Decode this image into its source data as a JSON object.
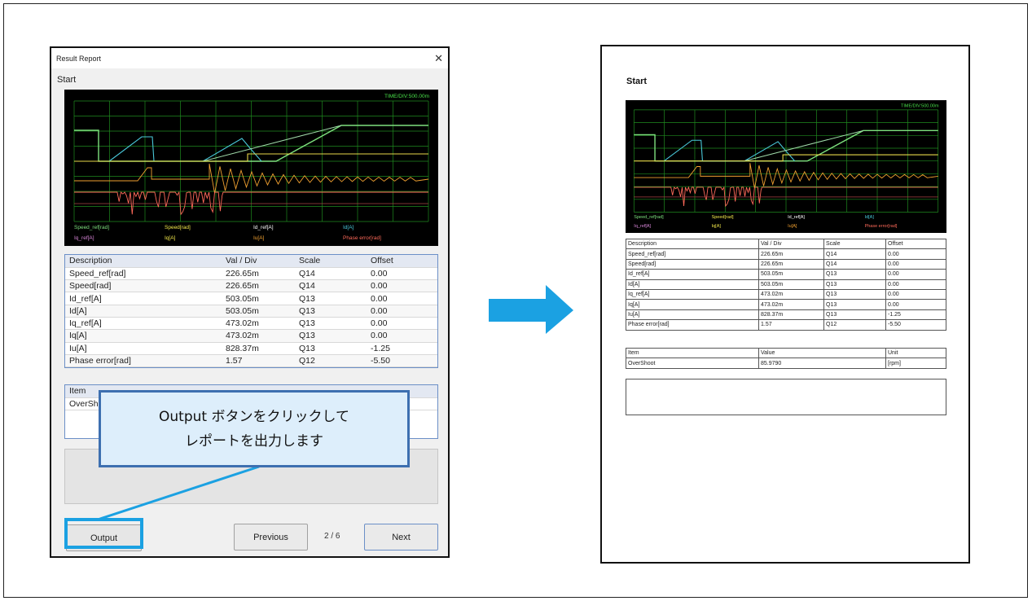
{
  "dialog": {
    "title": "Result Report",
    "section_title": "Start",
    "scope": {
      "time_div": "TIME/DIV:500.00m",
      "legend_row1": [
        {
          "label": "Speed_ref[rad]",
          "color": "#7ee07e"
        },
        {
          "label": "Speed[rad]",
          "color": "#f0e64a"
        },
        {
          "label": "Id_ref[A]",
          "color": "#ffffff"
        },
        {
          "label": "Id[A]",
          "color": "#49c7d8"
        }
      ],
      "legend_row2": [
        {
          "label": "Iq_ref[A]",
          "color": "#d986d9"
        },
        {
          "label": "Iq[A]",
          "color": "#f0e64a"
        },
        {
          "label": "Iu[A]",
          "color": "#f0a030"
        },
        {
          "label": "Phase error[rad]",
          "color": "#ff6a5a"
        }
      ]
    },
    "param_table": {
      "headers": [
        "Description",
        "Val / Div",
        "Scale",
        "Offset"
      ],
      "rows": [
        [
          "Speed_ref[rad]",
          "226.65m",
          "Q14",
          "0.00"
        ],
        [
          "Speed[rad]",
          "226.65m",
          "Q14",
          "0.00"
        ],
        [
          "Id_ref[A]",
          "503.05m",
          "Q13",
          "0.00"
        ],
        [
          "Id[A]",
          "503.05m",
          "Q13",
          "0.00"
        ],
        [
          "Iq_ref[A]",
          "473.02m",
          "Q13",
          "0.00"
        ],
        [
          "Iq[A]",
          "473.02m",
          "Q13",
          "0.00"
        ],
        [
          "Iu[A]",
          "828.37m",
          "Q13",
          "-1.25"
        ],
        [
          "Phase error[rad]",
          "1.57",
          "Q12",
          "-5.50"
        ]
      ]
    },
    "result_table": {
      "headers": [
        "Item"
      ],
      "rows": [
        [
          "OverSho"
        ]
      ]
    },
    "buttons": {
      "output": "Output",
      "previous": "Previous",
      "next": "Next"
    },
    "page_indicator": "2 / 6"
  },
  "callout": {
    "line1": "Output ボタンをクリックして",
    "line2": "レポートを出力します"
  },
  "report": {
    "title": "Start",
    "param_table": {
      "headers": [
        "Description",
        "Val / Div",
        "Scale",
        "Offset"
      ],
      "rows": [
        [
          "Speed_ref[rad]",
          "226.65m",
          "Q14",
          "0.00"
        ],
        [
          "Speed[rad]",
          "226.65m",
          "Q14",
          "0.00"
        ],
        [
          "Id_ref[A]",
          "503.05m",
          "Q13",
          "0.00"
        ],
        [
          "Id[A]",
          "503.05m",
          "Q13",
          "0.00"
        ],
        [
          "Iq_ref[A]",
          "473.02m",
          "Q13",
          "0.00"
        ],
        [
          "Iq[A]",
          "473.02m",
          "Q13",
          "0.00"
        ],
        [
          "Iu[A]",
          "828.37m",
          "Q13",
          "-1.25"
        ],
        [
          "Phase error[rad]",
          "1.57",
          "Q12",
          "-5.50"
        ]
      ]
    },
    "result_table": {
      "headers": [
        "Item",
        "Value",
        "Unit"
      ],
      "rows": [
        [
          "OverShoot",
          "85.9790",
          "[rpm]"
        ]
      ]
    }
  },
  "colors": {
    "highlight": "#1ba1e2",
    "callout_border": "#3d6fb0",
    "callout_fill": "#ddeefb",
    "grid": "#1f8a1f"
  }
}
